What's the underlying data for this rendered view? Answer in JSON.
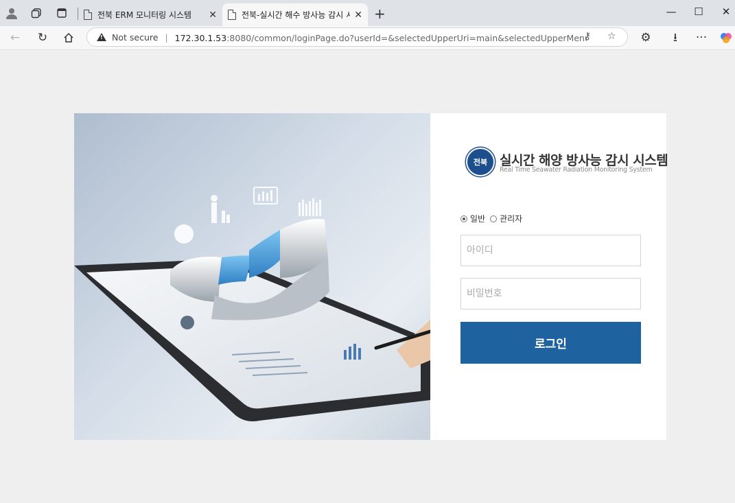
{
  "browser": {
    "tabs": [
      {
        "title": "전북 ERM 모니터링 시스템",
        "active": false
      },
      {
        "title": "전북-실시간 해수 방사능 감시 시스템",
        "active": true
      }
    ],
    "address": {
      "security_label": "Not secure",
      "host": "172.30.1.53",
      "path": ":8080/common/loginPage.do?userId=&selectedUpperUri=main&selectedUpperMenu=지도메..."
    }
  },
  "login": {
    "emblem_text": "전북",
    "brand_ko": "실시간 해양 방사능 감시 시스템",
    "brand_en": "Real Time Seawater Radiation Monitoring System",
    "role_general": "일반",
    "role_admin": "관리자",
    "selected_role": "일반",
    "id_placeholder": "아이디",
    "id_value": "",
    "pw_placeholder": "비밀번호",
    "pw_value": "",
    "button_label": "로그인"
  },
  "colors": {
    "button": "#1f62a0",
    "emblem": "#1d4f8f",
    "page_bg": "#efefef"
  }
}
